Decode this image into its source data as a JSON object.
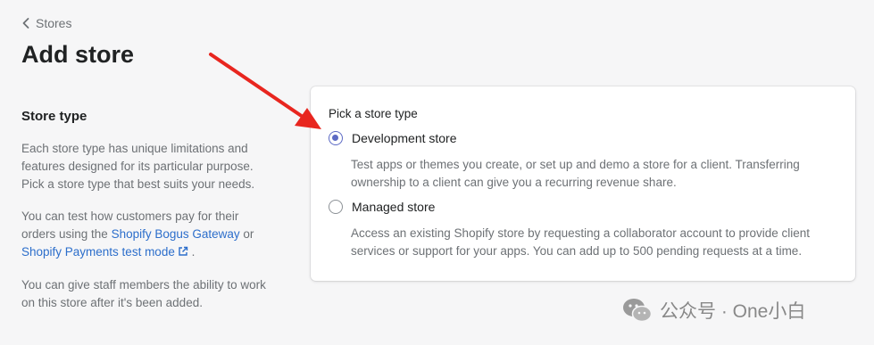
{
  "breadcrumb": {
    "label": "Stores"
  },
  "page": {
    "title": "Add store"
  },
  "sidebar": {
    "heading": "Store type",
    "paragraph1": "Each store type has unique limitations and features designed for its particular purpose. Pick a store type that best suits your needs.",
    "paragraph2_prefix": "You can test how customers pay for their orders using the ",
    "link_bogus": "Shopify Bogus Gateway",
    "paragraph2_or": " or ",
    "link_payments": "Shopify Payments test mode",
    "paragraph2_suffix": " .",
    "paragraph3": "You can give staff members the ability to work on this store after it's been added."
  },
  "form": {
    "pick_label": "Pick a store type",
    "options": [
      {
        "label": "Development store",
        "help": "Test apps or themes you create, or set up and demo a store for a client. Transferring ownership to a client can give you a recurring revenue share.",
        "selected": true
      },
      {
        "label": "Managed store",
        "help": "Access an existing Shopify store by requesting a collaborator account to provide client services or support for your apps. You can add up to 500 pending requests at a time.",
        "selected": false
      }
    ]
  },
  "watermark": {
    "text": "公众号 · One小白"
  },
  "colors": {
    "accent": "#5c6ac4",
    "link": "#2c6ecb",
    "arrow": "#e8261f",
    "background": "#f6f6f7"
  },
  "icons": [
    "chevron-left-icon",
    "external-link-icon",
    "wechat-icon"
  ]
}
